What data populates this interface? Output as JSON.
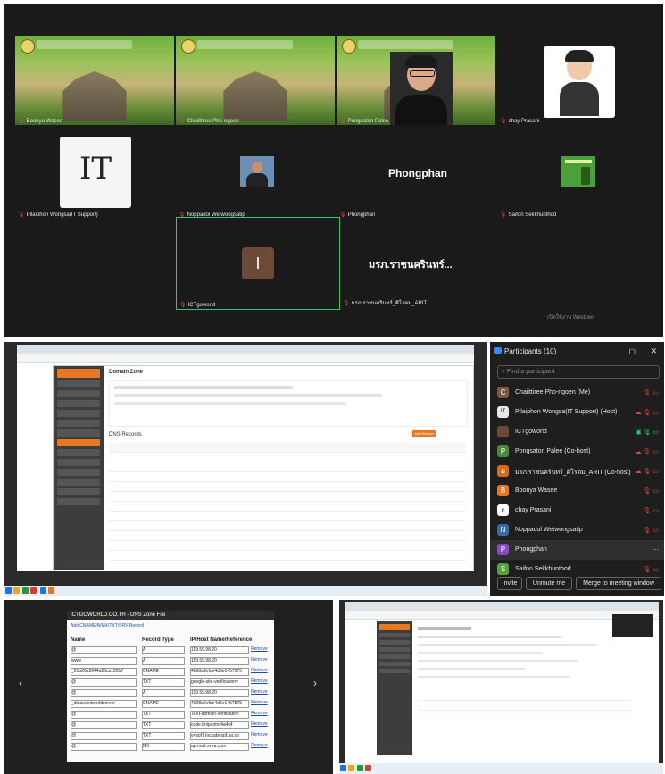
{
  "gallery": {
    "tiles": [
      {
        "name": "Boonya Wasee"
      },
      {
        "name": "Chaiittiree Pho-ngoen"
      },
      {
        "name": "Pongsaton Palee"
      },
      {
        "name": "chay Prasani"
      },
      {
        "name": "Pilaiphon Wongsa(IT Support)"
      },
      {
        "name": "Noppadol Wetwongsatip"
      },
      {
        "name": "Phongphan",
        "label": "Phongphan"
      },
      {
        "name": "Saifon Sekkhunthod"
      },
      {
        "name": "ICTgoworld",
        "initial": "I"
      },
      {
        "name": "มรภ.ราชนครินทร์_ศิโรตม_ARIT",
        "label": "มรภ.ราชนครินทร์..."
      }
    ],
    "watermark": "เปิดใช้งาน Windows"
  },
  "browser": {
    "page_heading": "Domain Zone",
    "section": "DNS Records",
    "add_button": "Add Record"
  },
  "participants": {
    "title": "Participants (10)",
    "find_placeholder": "Find a participant",
    "list": [
      {
        "name": "Chaiittiree Pho-ngoen (Me)",
        "avatar": "C",
        "color": "#7a5a3a"
      },
      {
        "name": "Pilaiphon Wongsa(IT Support) (Host)",
        "avatar": "IT",
        "color": "#e8e8e8"
      },
      {
        "name": "ICTgoworld",
        "avatar": "I",
        "color": "#6b4a3a"
      },
      {
        "name": "Pongsaton Palee (Co-host)",
        "avatar": "P",
        "color": "#4a8a3a"
      },
      {
        "name": "มรภ.ราชนครินทร์_ศิโรตม_ARIT (Co-host)",
        "avatar": "ม",
        "color": "#d86a1a"
      },
      {
        "name": "Boonya Wasee",
        "avatar": "B",
        "color": "#e87722"
      },
      {
        "name": "chay Prasani",
        "avatar": "c",
        "color": "#ffffff"
      },
      {
        "name": "Noppadol Wetwongsatip",
        "avatar": "N",
        "color": "#3a6aa0"
      },
      {
        "name": "Phongphan",
        "avatar": "P",
        "color": "#8a4ac8"
      },
      {
        "name": "Saifon Sekkhunthod",
        "avatar": "S",
        "color": "#5aa03a"
      }
    ],
    "invite": "Invite",
    "unmute": "Unmute me",
    "merge": "Merge to meeting window"
  },
  "dns": {
    "title": "ICTGOWORLD.CO.TH - DNS Zone File",
    "add_link": "Add CNAME/A/MX/TXT/SRV Record",
    "headers": {
      "name": "Name",
      "type": "Record Type",
      "value": "IP/Host Name/Reference"
    },
    "remove": "Remove",
    "rows": [
      {
        "name": "@",
        "type": "A",
        "value": "119.59.98.20"
      },
      {
        "name": "www",
        "type": "A",
        "value": "119.59.98.20"
      },
      {
        "name": "_21b26a9944a98ca122b7",
        "type": "CNAME",
        "value": "4898a9efde4d6e1457575"
      },
      {
        "name": "@",
        "type": "TXT",
        "value": "google-site-verification="
      },
      {
        "name": "@",
        "type": "A",
        "value": "119.59.98.20"
      },
      {
        "name": "_dmarc.ictworldserver",
        "type": "CNAME",
        "value": "4898a9efde4d6e1457575"
      },
      {
        "name": "@",
        "type": "TXT",
        "value": "TeXt-domain-verification"
      },
      {
        "name": "@",
        "type": "TXT",
        "value": "code.bnipantro4a4s4"
      },
      {
        "name": "@",
        "type": "TXT",
        "value": "v=spf1 include:spf.ap.so"
      },
      {
        "name": "@",
        "type": "MX",
        "value": "ap.mail.ovea.com"
      }
    ]
  }
}
